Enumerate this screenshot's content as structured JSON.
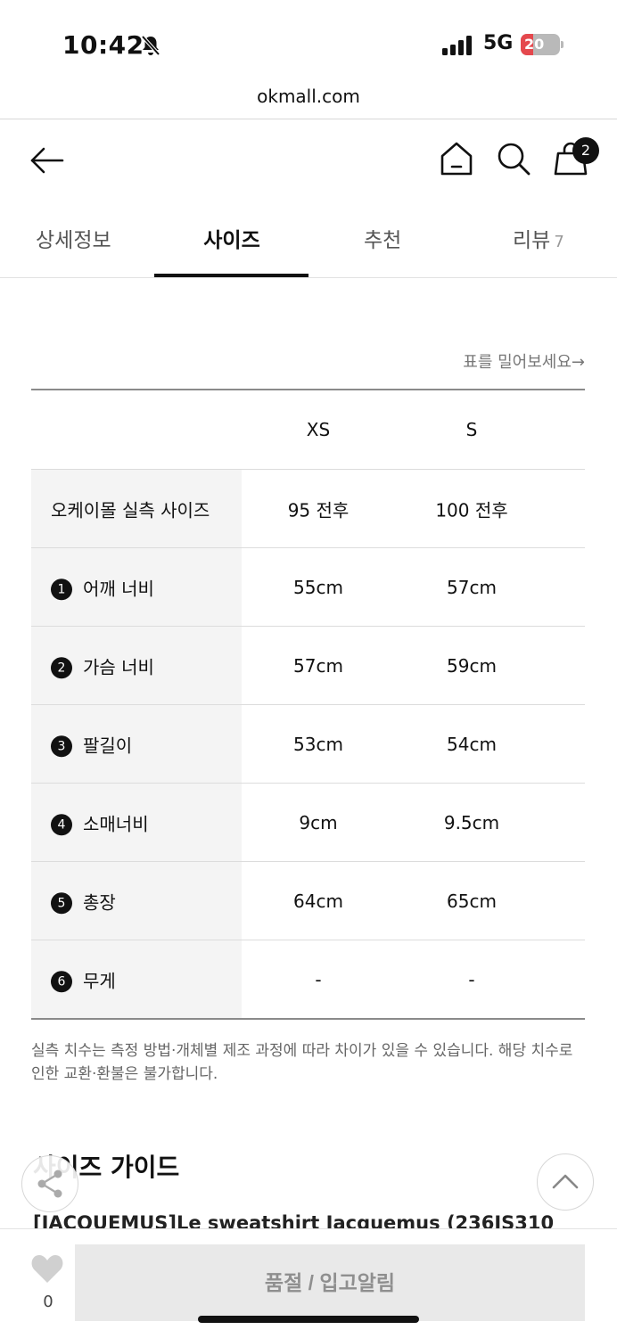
{
  "status_bar": {
    "time": "10:42",
    "network": "5G",
    "battery": "20",
    "battery_level": 0.2
  },
  "browser": {
    "url": "okmall.com"
  },
  "header": {
    "cart_count": "2",
    "icons": [
      "back-arrow-icon",
      "home-icon",
      "search-icon",
      "shopping-bag-icon"
    ]
  },
  "tabs": [
    {
      "label": "상세정보"
    },
    {
      "label": "사이즈",
      "active": true
    },
    {
      "label": "추천"
    },
    {
      "label": "리뷰",
      "count": "7"
    }
  ],
  "scroll_hint": "표를 밀어보세요→",
  "size_table": {
    "columns": [
      "XS",
      "S"
    ],
    "rows": [
      {
        "num": "",
        "label": "오케이몰 실측 사이즈",
        "values": [
          "95 전후",
          "100 전후"
        ]
      },
      {
        "num": "1",
        "label": "어깨 너비",
        "values": [
          "55cm",
          "57cm"
        ]
      },
      {
        "num": "2",
        "label": "가슴 너비",
        "values": [
          "57cm",
          "59cm"
        ]
      },
      {
        "num": "3",
        "label": "팔길이",
        "values": [
          "53cm",
          "54cm"
        ]
      },
      {
        "num": "4",
        "label": "소매너비",
        "values": [
          "9cm",
          "9.5cm"
        ]
      },
      {
        "num": "5",
        "label": "총장",
        "values": [
          "64cm",
          "65cm"
        ]
      },
      {
        "num": "6",
        "label": "무게",
        "values": [
          "-",
          "-"
        ]
      }
    ]
  },
  "disclaimer": "실측 치수는 측정 방법·개체별 제조 과정에 따라 차이가 있을 수 있습니다. 해당 치수로 인한 교환·환불은 불가합니다.",
  "guide": {
    "title": "사이즈 가이드",
    "product_line": "[JACQUEMUS]Le sweatshirt Jacquemus (236JS310"
  },
  "bottom_bar": {
    "like_count": "0",
    "button_label": "품절 / 입고알림"
  },
  "colors": {
    "accent": "#111111",
    "battery_low": "#e5484d",
    "label_bg": "#f4f4f4",
    "disabled_button": "#e9e9e9"
  }
}
